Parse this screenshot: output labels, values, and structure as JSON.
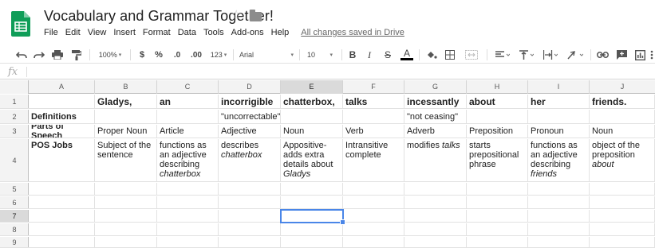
{
  "header": {
    "title": "Vocabulary and Grammar Together!",
    "menu": [
      "File",
      "Edit",
      "View",
      "Insert",
      "Format",
      "Data",
      "Tools",
      "Add-ons",
      "Help"
    ],
    "save_status": "All changes saved in Drive"
  },
  "toolbar": {
    "zoom": "100%",
    "currency": "$",
    "percent": "%",
    "decrease_decimal": ".0",
    "increase_decimal": ".00",
    "more_formats": "123",
    "font": "Arial",
    "font_size": "10",
    "bold": "B",
    "italic": "I",
    "strike": "S",
    "text_color": "A"
  },
  "formula_bar": {
    "icon": "fx",
    "value": ""
  },
  "grid": {
    "columns": [
      "A",
      "B",
      "C",
      "D",
      "E",
      "F",
      "G",
      "H",
      "I",
      "J"
    ],
    "rows": [
      "1",
      "2",
      "3",
      "4",
      "5",
      "6",
      "7",
      "8",
      "9"
    ],
    "selected_cell": "E7",
    "row1": [
      "",
      "Gladys,",
      "an",
      "incorrigible",
      "chatterbox,",
      "talks",
      "incessantly",
      "about",
      "her",
      "friends."
    ],
    "row2": [
      "Definitions",
      "",
      "",
      "\"uncorrectable\"",
      "",
      "",
      "\"not ceasing\"",
      "",
      "",
      ""
    ],
    "row3": [
      "Parts of Speech",
      "Proper Noun",
      "Article",
      "Adjective",
      "Noun",
      "Verb",
      "Adverb",
      "Preposition",
      "Pronoun",
      "Noun"
    ],
    "row4": {
      "A": "POS Jobs",
      "B": "Subject of the sentence",
      "C_text": "functions as an adjective describing",
      "C_italic": "chatterbox",
      "D_text": "describes",
      "D_italic": "chatterbox",
      "E_text": "Appositive-adds extra details about",
      "E_italic": "Gladys",
      "F": "Intransitive complete",
      "G_text": "modifies",
      "G_italic": "talks",
      "H": "starts prepositional phrase",
      "I_text": "functions as an adjective describing",
      "I_italic": "friends",
      "J_text": "object of the preposition",
      "J_italic": "about"
    }
  },
  "colors": {
    "sheets_green": "#0f9d58",
    "selection_blue": "#4a86e8",
    "header_gray": "#f3f3f3"
  }
}
